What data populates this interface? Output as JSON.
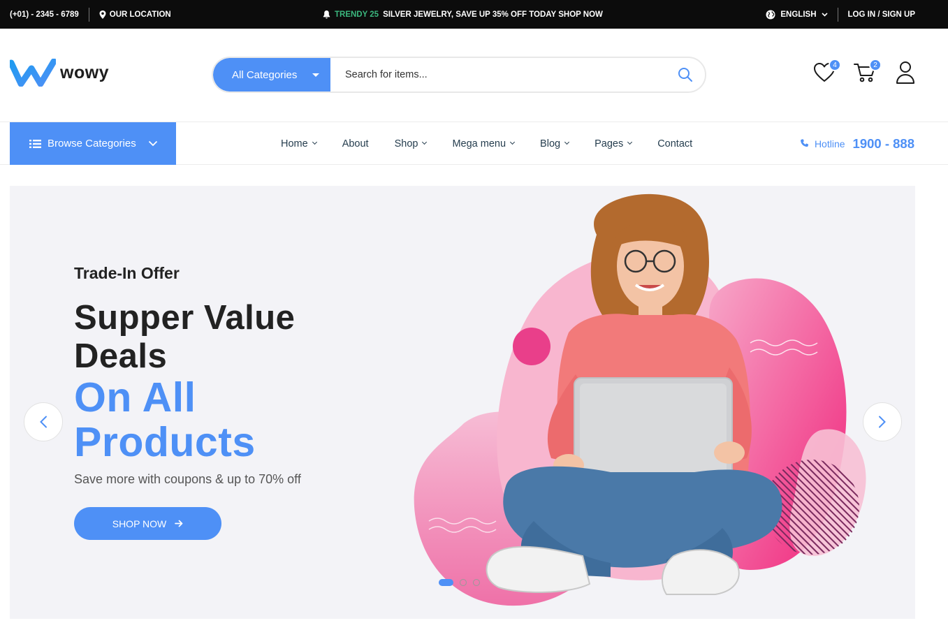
{
  "topbar": {
    "phone": "(+01) - 2345 - 6789",
    "location": "OUR LOCATION",
    "promo_highlight": "TRENDY 25",
    "promo_text": "SILVER JEWELRY, SAVE UP 35% OFF TODAY SHOP NOW",
    "language": "ENGLISH",
    "auth": "LOG IN / SIGN UP"
  },
  "header": {
    "logo_text": "wowy",
    "category_select": "All Categories",
    "search_placeholder": "Search for items...",
    "wishlist_count": "4",
    "cart_count": "2"
  },
  "nav": {
    "browse_label": "Browse Categories",
    "items": [
      {
        "label": "Home",
        "dropdown": true
      },
      {
        "label": "About",
        "dropdown": false
      },
      {
        "label": "Shop",
        "dropdown": true
      },
      {
        "label": "Mega menu",
        "dropdown": true
      },
      {
        "label": "Blog",
        "dropdown": true
      },
      {
        "label": "Pages",
        "dropdown": true
      },
      {
        "label": "Contact",
        "dropdown": false
      }
    ],
    "hotline_label": "Hotline",
    "hotline_number": "1900 - 888"
  },
  "hero": {
    "pretitle": "Trade-In Offer",
    "title_line1": "Supper Value",
    "title_line2": "Deals",
    "title_line3": "On All",
    "title_line4": "Products",
    "subtitle": "Save more with coupons & up to 70% off",
    "cta": "SHOP NOW",
    "slides": 3,
    "active_slide": 1
  },
  "colors": {
    "accent": "#4e90f6",
    "topbar_bg": "#0c0c0c",
    "promo_highlight": "#3bb77e",
    "hero_bg": "#f3f3f7",
    "blob_pink": "#f0237a"
  }
}
